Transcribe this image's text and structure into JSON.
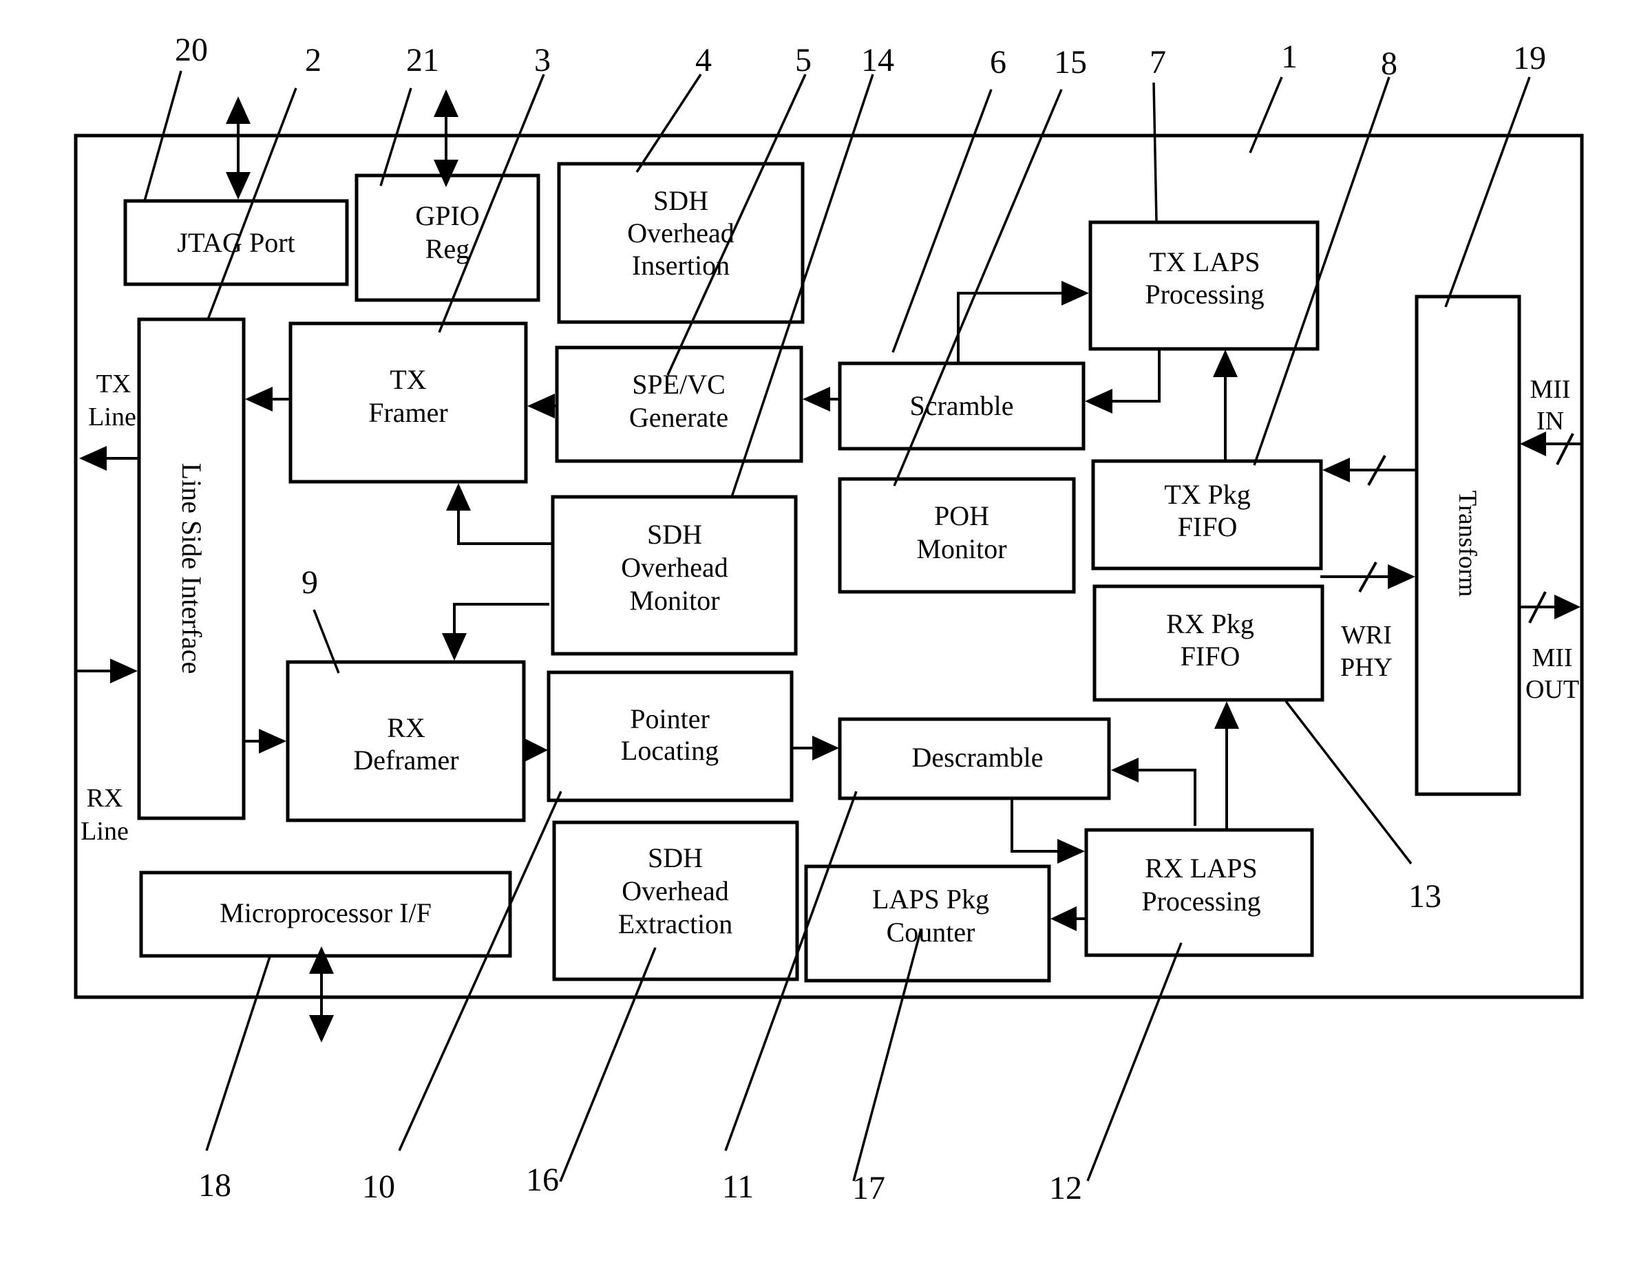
{
  "diagram": {
    "type": "block-diagram",
    "blocks": [
      {
        "id": "jtag_port",
        "ref": "20",
        "lines": [
          "JTAG Port"
        ]
      },
      {
        "id": "line_side_interface",
        "ref": "2",
        "lines": [
          "Line Side Interface"
        ]
      },
      {
        "id": "gpio_reg",
        "ref": "21",
        "lines": [
          "GPIO",
          "Reg"
        ]
      },
      {
        "id": "tx_framer",
        "ref": "3",
        "lines": [
          "TX",
          "Framer"
        ]
      },
      {
        "id": "sdh_oh_insertion",
        "ref": "4",
        "lines": [
          "SDH",
          "Overhead",
          "Insertion"
        ]
      },
      {
        "id": "spe_vc_generate",
        "ref": "5",
        "lines": [
          "SPE/VC",
          "Generate"
        ]
      },
      {
        "id": "sdh_oh_monitor",
        "ref": "14",
        "lines": [
          "SDH",
          "Overhead",
          "Monitor"
        ]
      },
      {
        "id": "scramble",
        "ref": "6",
        "lines": [
          "Scramble"
        ]
      },
      {
        "id": "poh_monitor",
        "ref": "15",
        "lines": [
          "POH",
          "Monitor"
        ]
      },
      {
        "id": "tx_laps_processing",
        "ref": "7",
        "lines": [
          "TX LAPS",
          "Processing"
        ]
      },
      {
        "id": "chip",
        "ref": "1",
        "lines": []
      },
      {
        "id": "tx_pkg_fifo",
        "ref": "8",
        "lines": [
          "TX Pkg",
          "FIFO"
        ]
      },
      {
        "id": "transform",
        "ref": "19",
        "lines": [
          "Transform"
        ]
      },
      {
        "id": "rx_deframer",
        "ref": "9",
        "lines": [
          "RX",
          "Deframer"
        ]
      },
      {
        "id": "pointer_locating",
        "ref": "10",
        "lines": [
          "Pointer",
          "Locating"
        ]
      },
      {
        "id": "descramble",
        "ref": "11",
        "lines": [
          "Descramble"
        ]
      },
      {
        "id": "rx_laps_processing",
        "ref": "12",
        "lines": [
          "RX LAPS",
          "Processing"
        ]
      },
      {
        "id": "rx_pkg_fifo",
        "ref": "13",
        "lines": [
          "RX Pkg",
          "FIFO"
        ]
      },
      {
        "id": "sdh_oh_extraction",
        "ref": "16",
        "lines": [
          "SDH",
          "Overhead",
          "Extraction"
        ]
      },
      {
        "id": "laps_pkg_counter",
        "ref": "17",
        "lines": [
          "LAPS Pkg",
          "Counter"
        ]
      },
      {
        "id": "microprocessor_if",
        "ref": "18",
        "lines": [
          "Microprocessor I/F"
        ]
      }
    ],
    "signal_labels": {
      "tx_line": [
        "TX",
        "Line"
      ],
      "rx_line": [
        "RX",
        "Line"
      ],
      "mii_in": [
        "MII",
        "IN"
      ],
      "mii_out": [
        "MII",
        "OUT"
      ],
      "wri_phy": [
        "WRI",
        "PHY"
      ]
    },
    "ref_numbers": {
      "top": [
        "20",
        "2",
        "21",
        "3",
        "4",
        "5",
        "14",
        "6",
        "15",
        "7",
        "1",
        "8",
        "19"
      ],
      "middle": [
        "9",
        "13"
      ],
      "bottom": [
        "18",
        "10",
        "16",
        "11",
        "17",
        "12"
      ]
    },
    "connections": [
      {
        "from": "tx_laps_processing",
        "to": "scramble"
      },
      {
        "from": "scramble",
        "to": "tx_laps_processing"
      },
      {
        "from": "scramble",
        "to": "spe_vc_generate"
      },
      {
        "from": "spe_vc_generate",
        "to": "tx_framer"
      },
      {
        "from": "tx_framer",
        "to": "line_side_interface"
      },
      {
        "from": "line_side_interface",
        "to": "tx_line"
      },
      {
        "from": "rx_line",
        "to": "line_side_interface"
      },
      {
        "from": "line_side_interface",
        "to": "rx_deframer"
      },
      {
        "from": "sdh_oh_monitor",
        "to": "tx_framer"
      },
      {
        "from": "sdh_oh_monitor",
        "to": "rx_deframer"
      },
      {
        "from": "rx_deframer",
        "to": "pointer_locating"
      },
      {
        "from": "pointer_locating",
        "to": "descramble"
      },
      {
        "from": "descramble",
        "to": "rx_laps_processing"
      },
      {
        "from": "rx_laps_processing",
        "to": "descramble"
      },
      {
        "from": "rx_laps_processing",
        "to": "rx_pkg_fifo"
      },
      {
        "from": "rx_laps_processing",
        "to": "laps_pkg_counter"
      },
      {
        "from": "tx_pkg_fifo",
        "to": "tx_laps_processing"
      },
      {
        "from": "transform",
        "to": "tx_pkg_fifo",
        "bus": true
      },
      {
        "from": "rx_pkg_fifo",
        "to": "transform",
        "bus": true
      },
      {
        "from": "mii_in",
        "to": "transform",
        "bus": true
      },
      {
        "from": "transform",
        "to": "mii_out",
        "bus": true
      },
      {
        "from": "external",
        "to": "jtag_port",
        "bidirectional": true
      },
      {
        "from": "external",
        "to": "gpio_reg",
        "bidirectional": true
      },
      {
        "from": "microprocessor_if",
        "to": "external",
        "bidirectional": true
      }
    ]
  }
}
